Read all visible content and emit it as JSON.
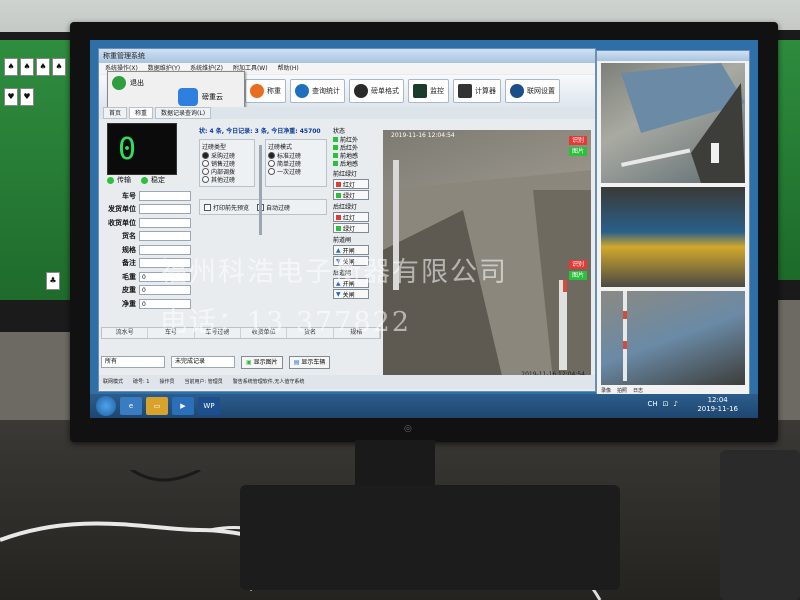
{
  "app": {
    "title": "称重管理系统",
    "menu": [
      "系统操作(X)",
      "数据维护(Y)",
      "系统维护(Z)",
      "附加工具(W)",
      "帮助(H)"
    ],
    "toolbar": [
      "退出",
      "称重",
      "查询统计",
      "磅单格式",
      "监控",
      "计算器",
      "联网设置"
    ],
    "popup": {
      "item1": "磅重云",
      "item2": "退出"
    },
    "tabs": [
      "首页",
      "称重",
      "数据记录查询(L)"
    ],
    "weight_display": "0",
    "status": {
      "transmit": "传输",
      "stable": "稳定"
    },
    "info_line": "状: 4 条, 今日记录: 3 条, 今日净重: 45700",
    "form": {
      "fields": [
        {
          "label": "车号",
          "value": ""
        },
        {
          "label": "发货单位",
          "value": ""
        },
        {
          "label": "收货单位",
          "value": ""
        },
        {
          "label": "货名",
          "value": ""
        },
        {
          "label": "规格",
          "value": ""
        },
        {
          "label": "备注",
          "value": ""
        },
        {
          "label": "毛重",
          "value": "0"
        },
        {
          "label": "皮重",
          "value": "0"
        },
        {
          "label": "净重",
          "value": "0"
        }
      ]
    },
    "filter_type": {
      "title": "过磅类型",
      "options": [
        "采购过磅",
        "销售过磅",
        "内部调拨",
        "其他过磅"
      ],
      "selected": 0
    },
    "filter_mode": {
      "title": "过磅模式",
      "options": [
        "标准过磅",
        "简单过磅",
        "一次过磅"
      ],
      "selected": 0
    },
    "checks": {
      "print_preview": "打印前先预览",
      "auto_weigh": "自动过磅"
    },
    "state_panel": {
      "title": "状态",
      "sensors": [
        "前红外",
        "后红外",
        "前地感",
        "后地感"
      ],
      "front_light": "前红绿灯",
      "rear_light": "后红绿灯",
      "front_gate": "前道闸",
      "rear_gate": "后道闸",
      "red": "红灯",
      "green": "绿灯",
      "open": "开闸",
      "close": "关闸"
    },
    "camera": {
      "timestamp_top": "2019-11-16 12:04:54",
      "timestamp_bottom": "2019-11-16 12:04:54",
      "btn_record": "识别",
      "btn_image": "图片"
    },
    "grid_columns": [
      "流水号",
      "车号",
      "车号过磅",
      "收货单位",
      "货名",
      "规格"
    ],
    "bottom": {
      "select_all": "所有",
      "select_incomplete": "未完成记录",
      "btn_show_image": "显示图片",
      "btn_show_record": "显示车辆"
    },
    "statusbar": [
      "联网模式",
      "磅号: 1",
      "操作员",
      "当前用户: 管理员",
      "警告系统管理软件,无人值守系统"
    ]
  },
  "camwin": {
    "tabs": [
      "录像",
      "拍照",
      "日志"
    ]
  },
  "taskbar": {
    "app_label": "WP",
    "tray": "CH",
    "time": "12:04",
    "date": "2019-11-16"
  },
  "watermark": {
    "line1": "福州科浩电子衡器有限公司",
    "line2": "电话：13          377822"
  },
  "colors": {
    "weight_digit": "#2ee05a",
    "status_green": "#2bbf3c",
    "status_red": "#e53935",
    "taskbar": "#1e4670"
  }
}
